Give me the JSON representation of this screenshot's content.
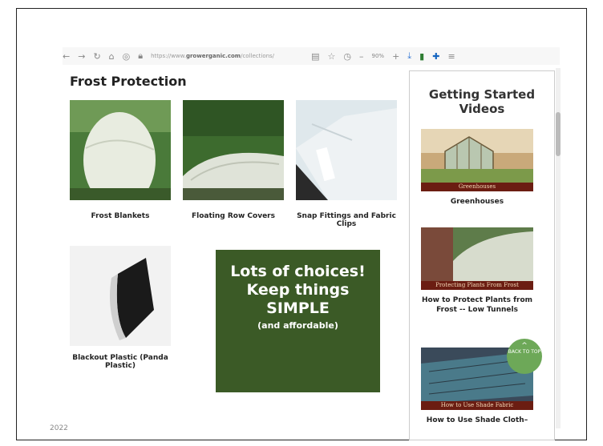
{
  "browser": {
    "url_prefix": "https://www.",
    "url_domain": "growerganic.com",
    "url_path": "/collections/",
    "zoom": "90%",
    "icons": [
      "back-icon",
      "forward-icon",
      "reload-icon",
      "home-icon",
      "shield-icon",
      "lock-icon",
      "reader-icon",
      "star-icon",
      "history-icon",
      "zoom-out-icon",
      "zoom-in-icon",
      "download-icon",
      "extension-icon",
      "puzzle-icon",
      "menu-icon"
    ]
  },
  "page": {
    "title": "Frost Protection",
    "products": [
      {
        "label": "Frost Blankets"
      },
      {
        "label": "Floating Row Covers"
      },
      {
        "label": "Snap Fittings and Fabric Clips"
      },
      {
        "label": "Blackout Plastic (Panda Plastic)"
      }
    ]
  },
  "sidebar": {
    "heading": "Getting Started Videos",
    "videos": [
      {
        "banner": "Greenhouses",
        "title": "Greenhouses"
      },
      {
        "banner": "Protecting Plants From Frost",
        "title": "How to Protect Plants from Frost -- Low Tunnels"
      },
      {
        "banner": "How to Use Shade Fabric",
        "title": "How to Use Shade Cloth–"
      }
    ],
    "back_to_top": "BACK TO TOP"
  },
  "callout": {
    "main": "Lots of choices! Keep things SIMPLE",
    "sub": "(and affordable)"
  },
  "footer": {
    "year": "2022"
  }
}
